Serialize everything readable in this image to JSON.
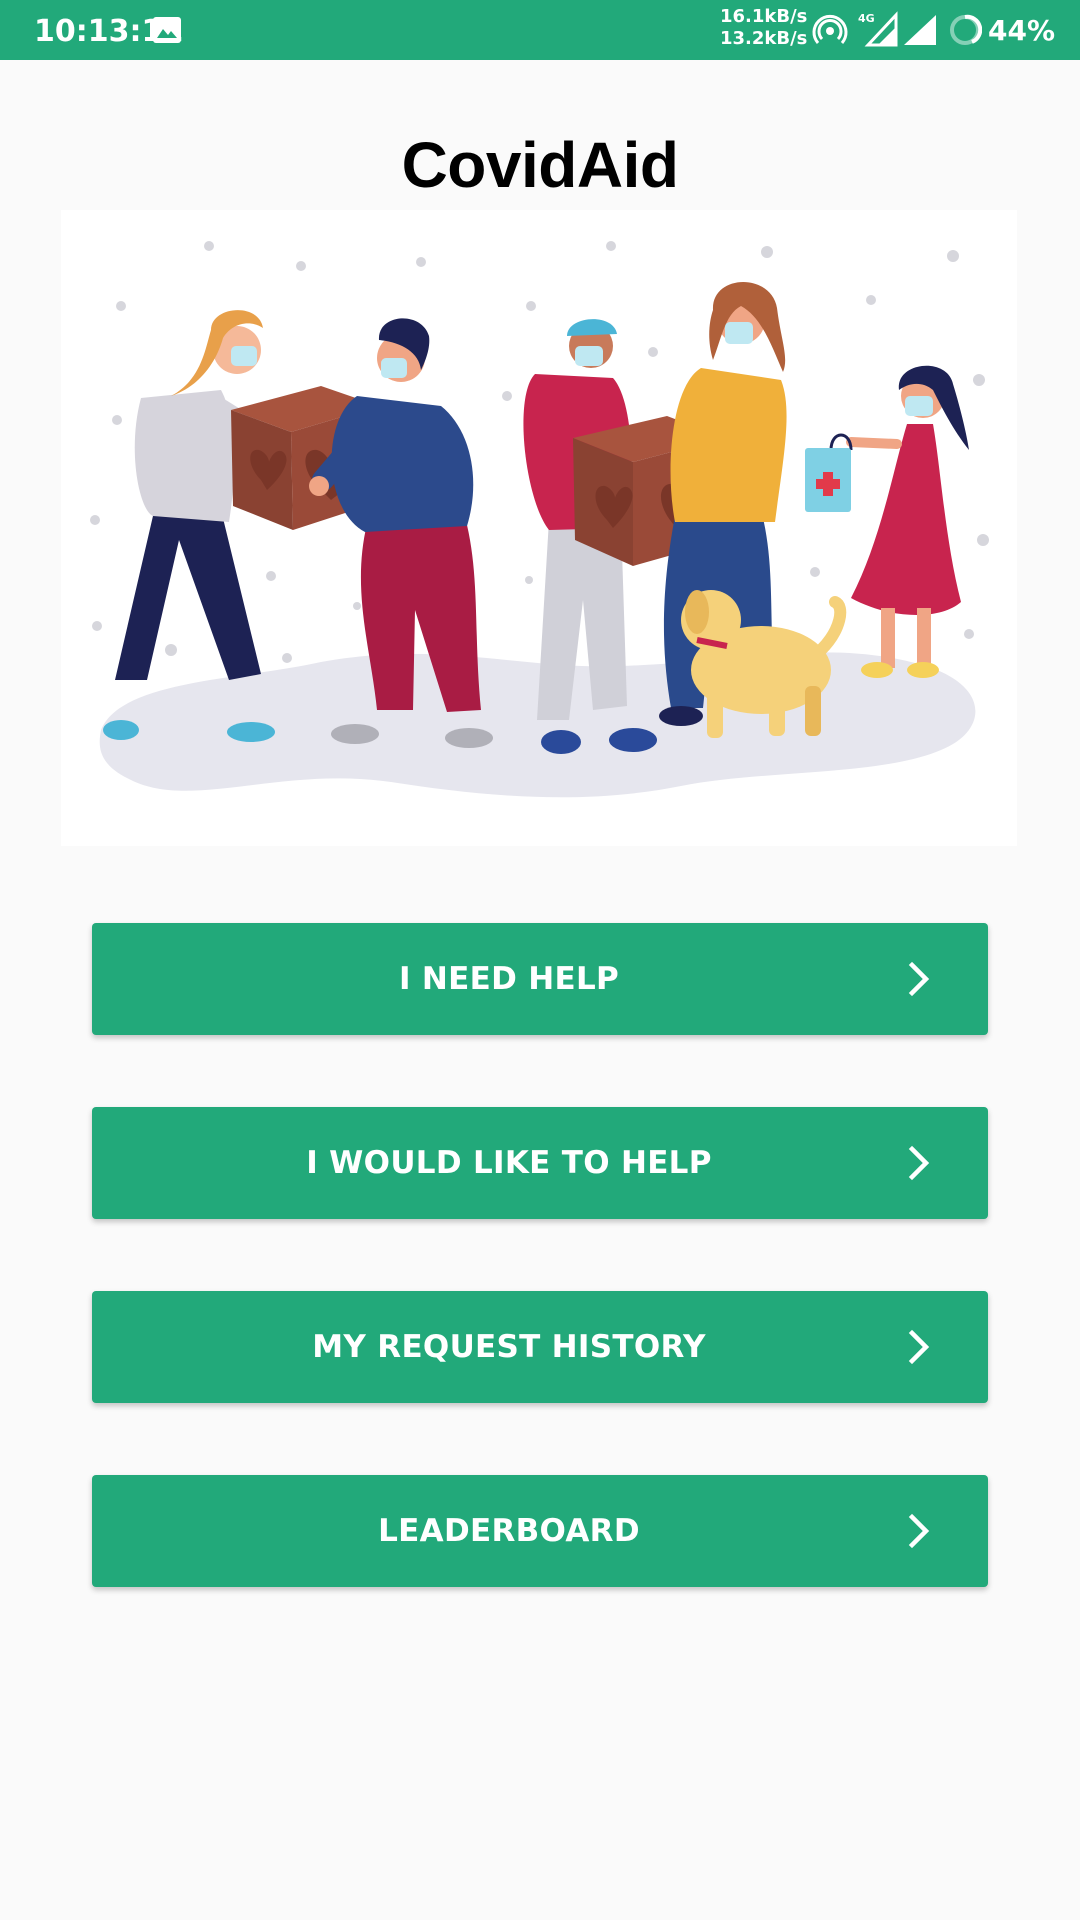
{
  "status_bar": {
    "time": "10:13:11",
    "speed_up": "16.1kB/s",
    "speed_down": "13.2kB/s",
    "network_type": "4G",
    "battery": "44%",
    "icons": [
      "gallery-icon",
      "hotspot-icon",
      "signal-4g-icon",
      "signal-icon",
      "battery-icon"
    ]
  },
  "app": {
    "title": "CovidAid"
  },
  "colors": {
    "primary": "#22a97a",
    "background": "#fafafa",
    "title_text": "#000000",
    "button_text": "#ffffff"
  },
  "menu": [
    {
      "label": "I NEED HELP",
      "icon": "chevron-right-icon"
    },
    {
      "label": "I WOULD LIKE TO HELP",
      "icon": "chevron-right-icon"
    },
    {
      "label": "MY REQUEST HISTORY",
      "icon": "chevron-right-icon"
    },
    {
      "label": "LEADERBOARD",
      "icon": "chevron-right-icon"
    }
  ]
}
